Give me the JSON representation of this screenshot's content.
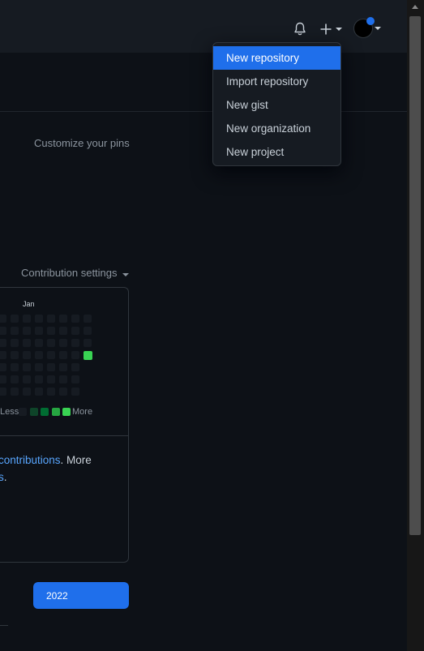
{
  "header": {
    "notifications_icon": "bell-icon",
    "create_icon": "plus-icon",
    "avatar_icon": "avatar"
  },
  "create_menu": {
    "items": [
      {
        "label": "New repository",
        "active": true
      },
      {
        "label": "Import repository",
        "active": false
      },
      {
        "label": "New gist",
        "active": false
      },
      {
        "label": "New organization",
        "active": false
      },
      {
        "label": "New project",
        "active": false
      }
    ]
  },
  "pins": {
    "customize_label": "Customize your pins"
  },
  "contributions": {
    "settings_label": "Contribution settings",
    "month_label": "Jan",
    "legend_less": "Less",
    "legend_more": "More",
    "legend_colors": [
      "#161b22",
      "#0e4429",
      "#006d32",
      "#26a641",
      "#39d353"
    ],
    "highlight_color": "#39d353",
    "learn_text_link": "contributions",
    "learn_text_rest": ". More",
    "learn_text_link2": "s",
    "learn_text_end": "."
  },
  "year_button": {
    "label": "2022"
  },
  "colors": {
    "background": "#0d1117",
    "header": "#161b22",
    "accent": "#1f6feb",
    "link": "#58a6ff"
  }
}
